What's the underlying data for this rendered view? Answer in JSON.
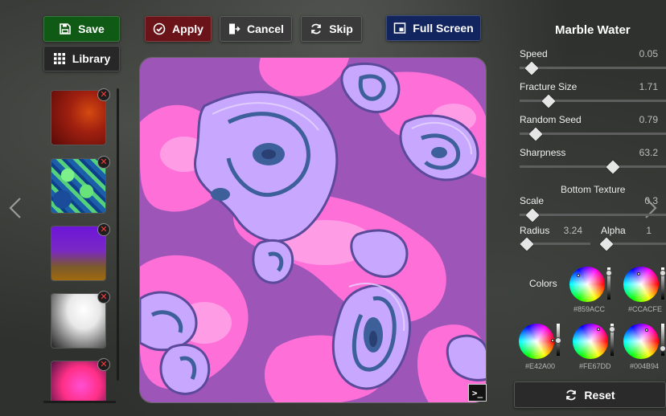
{
  "toolbar": {
    "save_label": "Save",
    "library_label": "Library",
    "apply_label": "Apply",
    "cancel_label": "Cancel",
    "skip_label": "Skip",
    "fullscreen_label": "Full Screen"
  },
  "thumbnails": [
    {
      "name": "thumbnail-lava"
    },
    {
      "name": "thumbnail-green-blue"
    },
    {
      "name": "thumbnail-purple-gold"
    },
    {
      "name": "thumbnail-white-smoke"
    },
    {
      "name": "thumbnail-pink-magenta"
    }
  ],
  "panel": {
    "title": "Marble Water",
    "sliders": [
      {
        "label": "Speed",
        "value": "0.05",
        "fraction": 0.08
      },
      {
        "label": "Fracture Size",
        "value": "1.71",
        "fraction": 0.2
      },
      {
        "label": "Random Seed",
        "value": "0.79",
        "fraction": 0.11
      },
      {
        "label": "Sharpness",
        "value": "63.2",
        "fraction": 0.64
      }
    ],
    "bottom_texture": {
      "title": "Bottom Texture",
      "scale_label": "Scale",
      "scale_value": "0.3",
      "scale_fraction": 0.09,
      "radius_label": "Radius",
      "radius_value": "3.24",
      "radius_fraction": 0.1,
      "alpha_label": "Alpha",
      "alpha_value": "1",
      "alpha_fraction": 0.05
    },
    "colors_label": "Colors",
    "colors": [
      {
        "hex": "#859ACC"
      },
      {
        "hex": "#CCACFE"
      },
      {
        "hex": "#E42A00"
      },
      {
        "hex": "#FE67DD"
      },
      {
        "hex": "#004B94"
      }
    ],
    "reset_label": "Reset"
  },
  "console_label": ">_",
  "icons": {
    "save": "floppy-disk-icon",
    "library": "grid-icon",
    "apply": "check-circle-icon",
    "cancel": "exit-door-icon",
    "skip": "refresh-icon",
    "fullscreen": "fullscreen-window-icon",
    "reset": "refresh-icon",
    "thumb_delete": "close-icon"
  },
  "accent_colors": {
    "save": "#0f5a14",
    "apply": "#6a1318",
    "fullscreen": "#12255e",
    "preview_pink": "#ff6fd8",
    "preview_lavender": "#c8a8ff",
    "preview_blue": "#3d5f9a"
  }
}
